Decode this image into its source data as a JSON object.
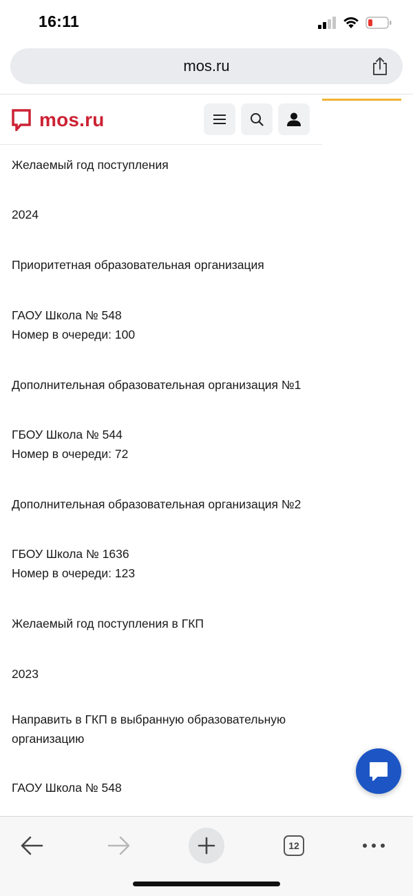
{
  "status": {
    "time": "16:11"
  },
  "browser": {
    "url": "mos.ru",
    "open_tabs": "12"
  },
  "site": {
    "logo_text": "mos.ru",
    "brand_color": "#cc2233"
  },
  "content": {
    "rows": [
      "Желаемый год поступления",
      "2024",
      "Приоритетная образовательная организация",
      "ГАОУ Школа № 548",
      "Номер в очереди: 100",
      "Дополнительная образовательная организация №1",
      "ГБОУ Школа № 544",
      "Номер в очереди: 72",
      "Дополнительная образовательная организация №2",
      "ГБОУ Школа № 1636",
      "Номер в очереди: 123",
      "Желаемый год поступления в ГКП",
      "2023",
      "Направить в ГКП в выбранную образовательную организацию",
      "ГАОУ Школа № 548"
    ]
  },
  "icons": {
    "header": [
      "menu-icon",
      "search-icon",
      "user-icon"
    ],
    "toolbar": [
      "back-arrow-icon",
      "forward-arrow-icon",
      "plus-icon",
      "tabs-icon",
      "more-icon"
    ],
    "chat": "chat-icon",
    "share": "share-icon"
  },
  "colors": {
    "accent_line": "#f2b233",
    "chat_button": "#1d56c4",
    "battery_low": "#e8352e"
  }
}
